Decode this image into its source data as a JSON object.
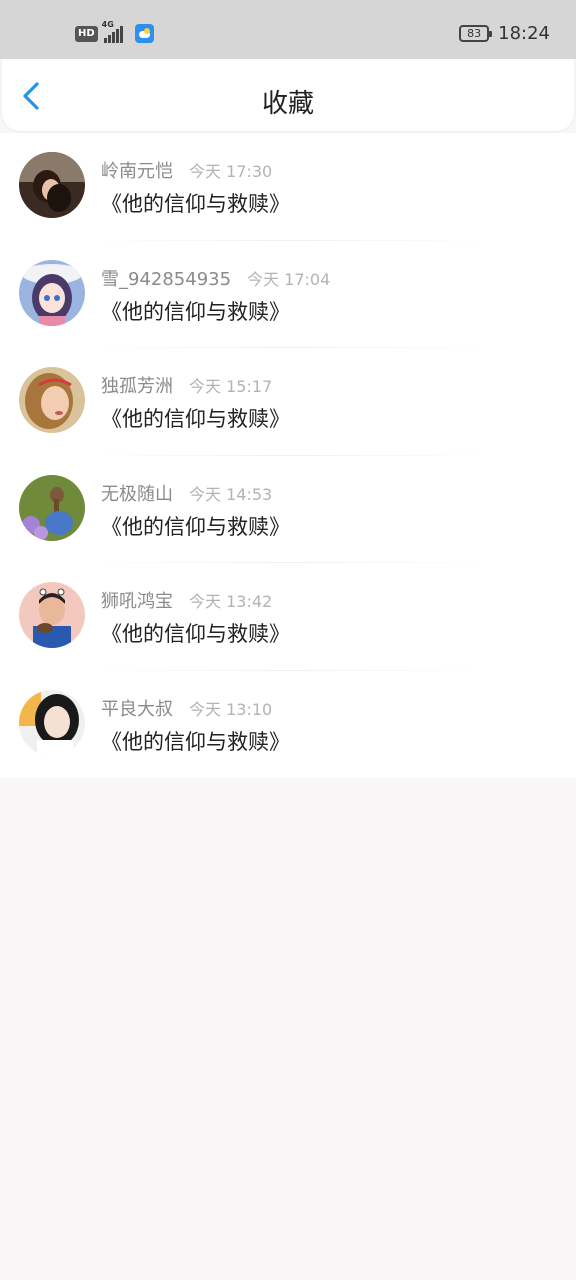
{
  "status_bar": {
    "hd": "HD",
    "network": "4G",
    "battery": "83",
    "time": "18:24"
  },
  "header": {
    "title": "收藏",
    "back_icon": "chevron-left-icon",
    "accent": "#2196e8"
  },
  "favorites": [
    {
      "user": "岭南元恺",
      "time": "今天 17:30",
      "book": "《他的信仰与救赎》"
    },
    {
      "user": "雪_942854935",
      "time": "今天 17:04",
      "book": "《他的信仰与救赎》"
    },
    {
      "user": "独孤芳洲",
      "time": "今天 15:17",
      "book": "《他的信仰与救赎》"
    },
    {
      "user": "无极随山",
      "time": "今天 14:53",
      "book": "《他的信仰与救赎》"
    },
    {
      "user": "狮吼鸿宝",
      "time": "今天 13:42",
      "book": "《他的信仰与救赎》"
    },
    {
      "user": "平良大叔",
      "time": "今天 13:10",
      "book": "《他的信仰与救赎》"
    }
  ]
}
